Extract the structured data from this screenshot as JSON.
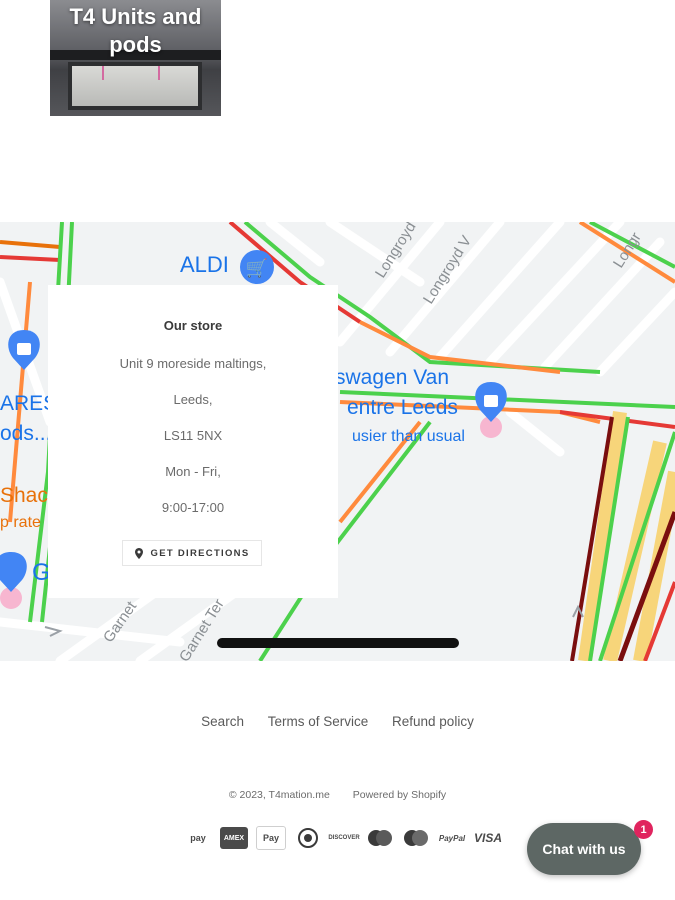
{
  "collection": {
    "title": "T4 Units and pods"
  },
  "map": {
    "labels": {
      "aldi": "ALDI",
      "vw_line1": "swagen Van",
      "vw_line2": "entre Leeds",
      "vw_line3": "usier than usual",
      "ares_line1": "ARES",
      "ares_line2": "ods...",
      "shac_line1": "Shac",
      "shac_line2": "p rate",
      "g": "G"
    },
    "streets": {
      "s1": "Longroyd",
      "s2": "Longroyd V",
      "s3": "Longr",
      "s4": "Garnet",
      "s5": "Garnet Ter"
    }
  },
  "store": {
    "heading": "Our store",
    "address_line1": "Unit 9 moreside maltings,",
    "address_line2": "Leeds,",
    "postcode": "LS11 5NX",
    "days": "Mon - Fri,",
    "hours": "9:00-17:00",
    "directions_label": "GET DIRECTIONS"
  },
  "footer": {
    "links": [
      "Search",
      "Terms of Service",
      "Refund policy"
    ],
    "copyright": "© 2023, T4mation.me",
    "powered": "Powered by Shopify",
    "payments": [
      "amazon-pay",
      "american-express",
      "apple-pay",
      "diners-club",
      "discover",
      "maestro",
      "mastercard",
      "paypal",
      "visa"
    ],
    "payment_labels": {
      "amazon": "pay",
      "apple": "Pay",
      "discover": "DISCOVER",
      "paypal": "PayPal",
      "visa": "VISA"
    }
  },
  "chat": {
    "label": "Chat with us",
    "badge": "1"
  }
}
